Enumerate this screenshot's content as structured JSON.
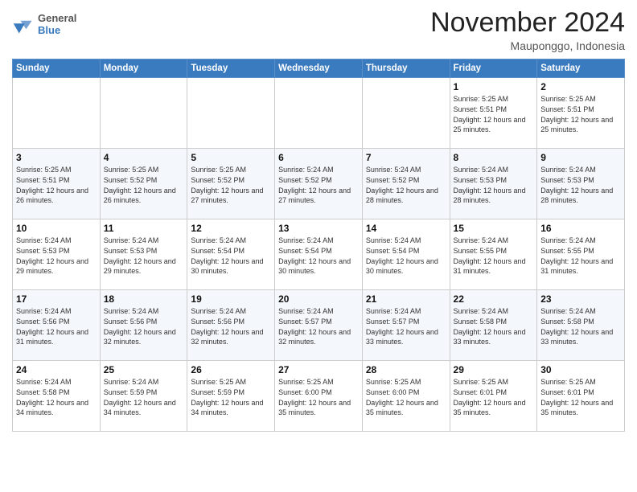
{
  "header": {
    "logo_general": "General",
    "logo_blue": "Blue",
    "month": "November 2024",
    "location": "Mauponggo, Indonesia"
  },
  "columns": [
    "Sunday",
    "Monday",
    "Tuesday",
    "Wednesday",
    "Thursday",
    "Friday",
    "Saturday"
  ],
  "rows": [
    [
      {
        "day": "",
        "info": ""
      },
      {
        "day": "",
        "info": ""
      },
      {
        "day": "",
        "info": ""
      },
      {
        "day": "",
        "info": ""
      },
      {
        "day": "",
        "info": ""
      },
      {
        "day": "1",
        "info": "Sunrise: 5:25 AM\nSunset: 5:51 PM\nDaylight: 12 hours and 25 minutes."
      },
      {
        "day": "2",
        "info": "Sunrise: 5:25 AM\nSunset: 5:51 PM\nDaylight: 12 hours and 25 minutes."
      }
    ],
    [
      {
        "day": "3",
        "info": "Sunrise: 5:25 AM\nSunset: 5:51 PM\nDaylight: 12 hours and 26 minutes."
      },
      {
        "day": "4",
        "info": "Sunrise: 5:25 AM\nSunset: 5:52 PM\nDaylight: 12 hours and 26 minutes."
      },
      {
        "day": "5",
        "info": "Sunrise: 5:25 AM\nSunset: 5:52 PM\nDaylight: 12 hours and 27 minutes."
      },
      {
        "day": "6",
        "info": "Sunrise: 5:24 AM\nSunset: 5:52 PM\nDaylight: 12 hours and 27 minutes."
      },
      {
        "day": "7",
        "info": "Sunrise: 5:24 AM\nSunset: 5:52 PM\nDaylight: 12 hours and 28 minutes."
      },
      {
        "day": "8",
        "info": "Sunrise: 5:24 AM\nSunset: 5:53 PM\nDaylight: 12 hours and 28 minutes."
      },
      {
        "day": "9",
        "info": "Sunrise: 5:24 AM\nSunset: 5:53 PM\nDaylight: 12 hours and 28 minutes."
      }
    ],
    [
      {
        "day": "10",
        "info": "Sunrise: 5:24 AM\nSunset: 5:53 PM\nDaylight: 12 hours and 29 minutes."
      },
      {
        "day": "11",
        "info": "Sunrise: 5:24 AM\nSunset: 5:53 PM\nDaylight: 12 hours and 29 minutes."
      },
      {
        "day": "12",
        "info": "Sunrise: 5:24 AM\nSunset: 5:54 PM\nDaylight: 12 hours and 30 minutes."
      },
      {
        "day": "13",
        "info": "Sunrise: 5:24 AM\nSunset: 5:54 PM\nDaylight: 12 hours and 30 minutes."
      },
      {
        "day": "14",
        "info": "Sunrise: 5:24 AM\nSunset: 5:54 PM\nDaylight: 12 hours and 30 minutes."
      },
      {
        "day": "15",
        "info": "Sunrise: 5:24 AM\nSunset: 5:55 PM\nDaylight: 12 hours and 31 minutes."
      },
      {
        "day": "16",
        "info": "Sunrise: 5:24 AM\nSunset: 5:55 PM\nDaylight: 12 hours and 31 minutes."
      }
    ],
    [
      {
        "day": "17",
        "info": "Sunrise: 5:24 AM\nSunset: 5:56 PM\nDaylight: 12 hours and 31 minutes."
      },
      {
        "day": "18",
        "info": "Sunrise: 5:24 AM\nSunset: 5:56 PM\nDaylight: 12 hours and 32 minutes."
      },
      {
        "day": "19",
        "info": "Sunrise: 5:24 AM\nSunset: 5:56 PM\nDaylight: 12 hours and 32 minutes."
      },
      {
        "day": "20",
        "info": "Sunrise: 5:24 AM\nSunset: 5:57 PM\nDaylight: 12 hours and 32 minutes."
      },
      {
        "day": "21",
        "info": "Sunrise: 5:24 AM\nSunset: 5:57 PM\nDaylight: 12 hours and 33 minutes."
      },
      {
        "day": "22",
        "info": "Sunrise: 5:24 AM\nSunset: 5:58 PM\nDaylight: 12 hours and 33 minutes."
      },
      {
        "day": "23",
        "info": "Sunrise: 5:24 AM\nSunset: 5:58 PM\nDaylight: 12 hours and 33 minutes."
      }
    ],
    [
      {
        "day": "24",
        "info": "Sunrise: 5:24 AM\nSunset: 5:58 PM\nDaylight: 12 hours and 34 minutes."
      },
      {
        "day": "25",
        "info": "Sunrise: 5:24 AM\nSunset: 5:59 PM\nDaylight: 12 hours and 34 minutes."
      },
      {
        "day": "26",
        "info": "Sunrise: 5:25 AM\nSunset: 5:59 PM\nDaylight: 12 hours and 34 minutes."
      },
      {
        "day": "27",
        "info": "Sunrise: 5:25 AM\nSunset: 6:00 PM\nDaylight: 12 hours and 35 minutes."
      },
      {
        "day": "28",
        "info": "Sunrise: 5:25 AM\nSunset: 6:00 PM\nDaylight: 12 hours and 35 minutes."
      },
      {
        "day": "29",
        "info": "Sunrise: 5:25 AM\nSunset: 6:01 PM\nDaylight: 12 hours and 35 minutes."
      },
      {
        "day": "30",
        "info": "Sunrise: 5:25 AM\nSunset: 6:01 PM\nDaylight: 12 hours and 35 minutes."
      }
    ]
  ]
}
